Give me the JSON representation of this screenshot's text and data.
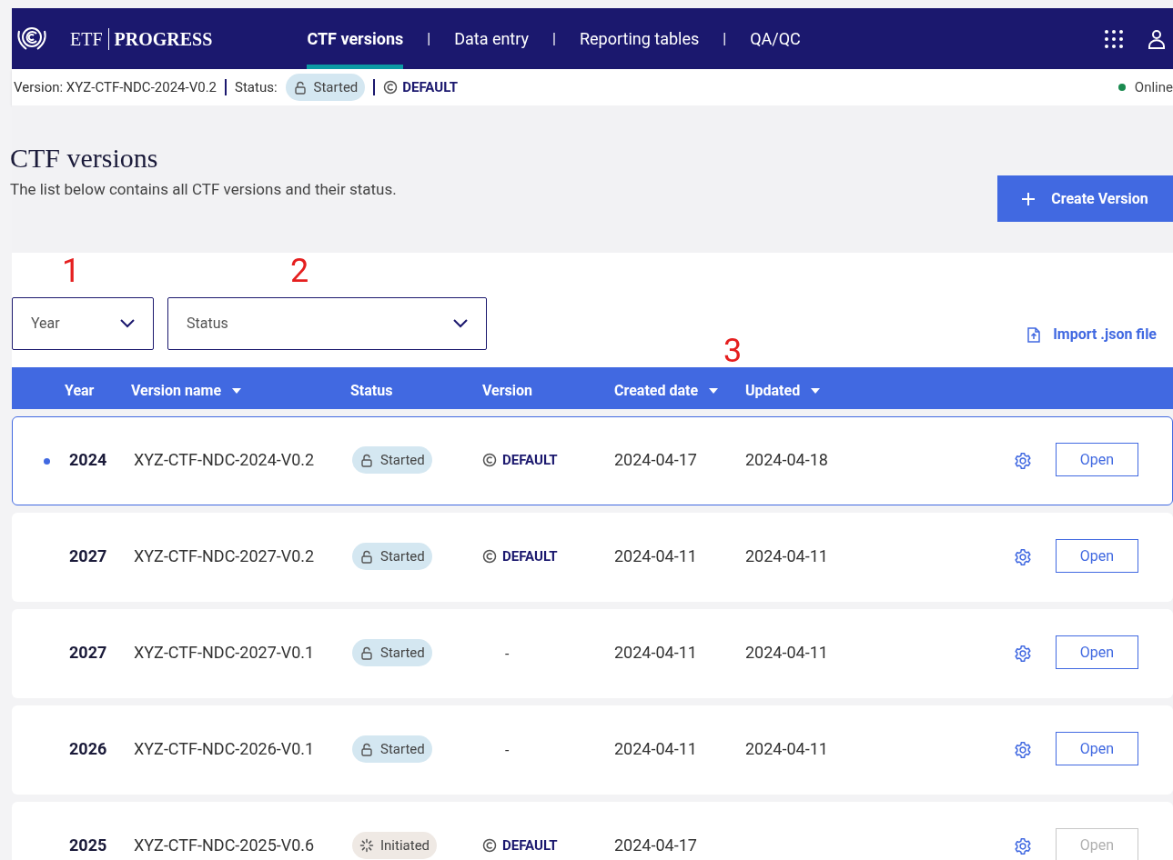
{
  "header": {
    "brand_left": "ETF",
    "brand_right": "PROGRESS",
    "nav": [
      {
        "label": "CTF versions",
        "selected": true
      },
      {
        "label": "Data entry",
        "selected": false
      },
      {
        "label": "Reporting tables",
        "selected": false
      },
      {
        "label": "QA/QC",
        "selected": false
      }
    ],
    "separator": "|"
  },
  "status_bar": {
    "version": "Version: XYZ-CTF-NDC-2024-V0.2",
    "status_label": "Status:",
    "status": {
      "label": "Started",
      "kind": "started"
    },
    "default_label": "DEFAULT",
    "connection": "Online",
    "online": true
  },
  "page": {
    "title": "CTF versions",
    "description": "The list below contains all CTF versions and their status.",
    "create_button": "Create Version"
  },
  "filters": [
    {
      "placeholder": "Year",
      "annotation": "1"
    },
    {
      "placeholder": "Status",
      "annotation": "2"
    }
  ],
  "import_link": "Import .json file",
  "table_annotation": "3",
  "table": {
    "columns": [
      {
        "label": "Year",
        "sortable": false
      },
      {
        "label": "Version name",
        "sortable": true
      },
      {
        "label": "Status",
        "sortable": false
      },
      {
        "label": "Version",
        "sortable": false
      },
      {
        "label": "Created date",
        "sortable": true
      },
      {
        "label": "Updated",
        "sortable": true
      }
    ],
    "rows": [
      {
        "year": "2024",
        "name": "XYZ-CTF-NDC-2024-V0.2",
        "status": {
          "label": "Started",
          "kind": "started"
        },
        "version": "DEFAULT",
        "created": "2024-04-17",
        "updated": "2024-04-18",
        "selected": true,
        "action": "Open",
        "disabled": false
      },
      {
        "year": "2027",
        "name": "XYZ-CTF-NDC-2027-V0.2",
        "status": {
          "label": "Started",
          "kind": "started"
        },
        "version": "DEFAULT",
        "created": "2024-04-11",
        "updated": "2024-04-11",
        "selected": false,
        "action": "Open",
        "disabled": false
      },
      {
        "year": "2027",
        "name": "XYZ-CTF-NDC-2027-V0.1",
        "status": {
          "label": "Started",
          "kind": "started"
        },
        "version": "-",
        "created": "2024-04-11",
        "updated": "2024-04-11",
        "selected": false,
        "action": "Open",
        "disabled": false
      },
      {
        "year": "2026",
        "name": "XYZ-CTF-NDC-2026-V0.1",
        "status": {
          "label": "Started",
          "kind": "started"
        },
        "version": "-",
        "created": "2024-04-11",
        "updated": "2024-04-11",
        "selected": false,
        "action": "Open",
        "disabled": false
      },
      {
        "year": "2025",
        "name": "XYZ-CTF-NDC-2025-V0.6",
        "status": {
          "label": "Initiated",
          "kind": "initiated"
        },
        "version": "DEFAULT",
        "created": "2024-04-17",
        "selected": false,
        "action": "Open",
        "disabled": true
      }
    ]
  }
}
